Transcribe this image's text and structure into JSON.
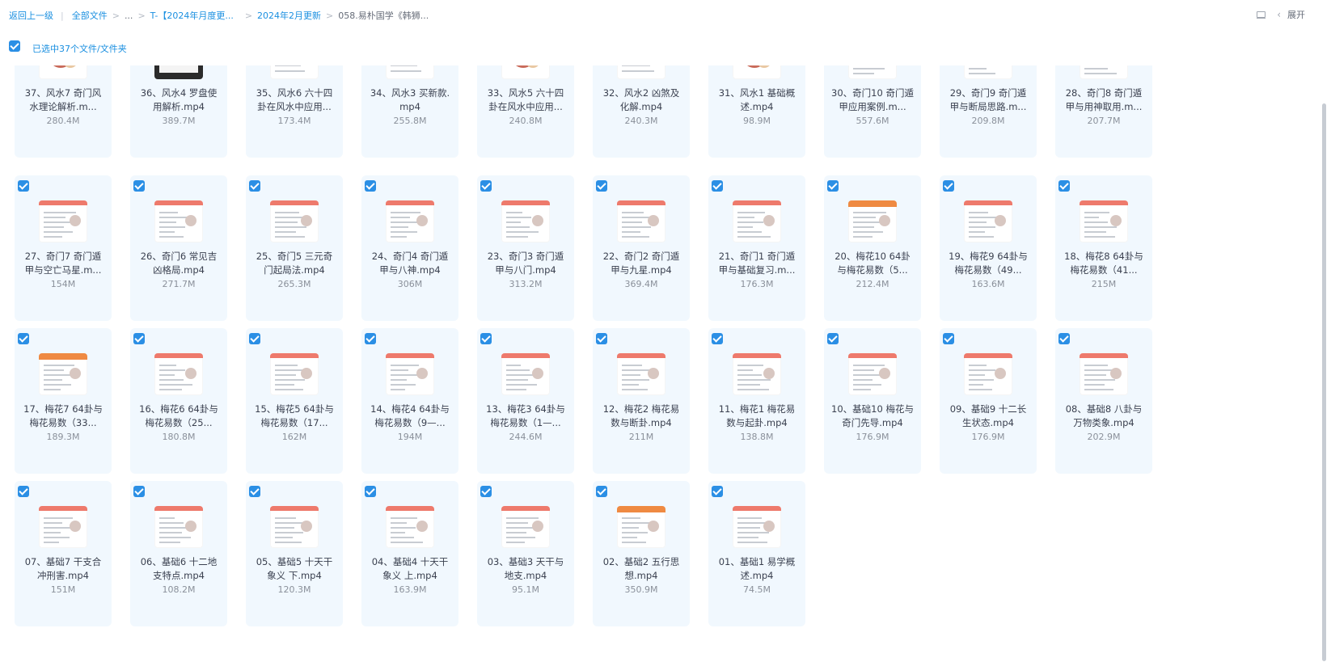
{
  "breadcrumb": {
    "back": "返回上一级",
    "all_files": "全部文件",
    "ellipsis": "...",
    "folder1": "T-【2024年月度更...",
    "folder2": "2024年2月更新",
    "current": "058.易朴国学《韩狮..."
  },
  "toolbar": {
    "expand_label": "展开",
    "layout_icon": "list-layout-icon",
    "chevron_icon": "chevron-left-icon"
  },
  "selection": {
    "text": "已选中37个文件/文件夹"
  },
  "files": [
    {
      "name": "37、风水7 奇门风\n水理论解析.m...",
      "size": "280.4M",
      "thumb": "photo"
    },
    {
      "name": "36、风水4 罗盘使\n用解析.mp4",
      "size": "389.7M",
      "thumb": "dark"
    },
    {
      "name": "35、风水6 六十四\n卦在风水中应用...",
      "size": "173.4M",
      "thumb": "plain"
    },
    {
      "name": "34、风水3 买新款.\nmp4",
      "size": "255.8M",
      "thumb": "plain"
    },
    {
      "name": "33、风水5 六十四\n卦在风水中应用...",
      "size": "240.8M",
      "thumb": "photo"
    },
    {
      "name": "32、风水2 凶煞及\n化解.mp4",
      "size": "240.3M",
      "thumb": "plain"
    },
    {
      "name": "31、风水1 基础概\n述.mp4",
      "size": "98.9M",
      "thumb": "photo"
    },
    {
      "name": "30、奇门10 奇门遁\n甲应用案例.m...",
      "size": "557.6M",
      "thumb": "slide"
    },
    {
      "name": "29、奇门9 奇门遁\n甲与断局思路.m...",
      "size": "209.8M",
      "thumb": "slide"
    },
    {
      "name": "28、奇门8 奇门遁\n甲与用神取用.m...",
      "size": "207.7M",
      "thumb": "slide"
    },
    {
      "name": "27、奇门7 奇门遁\n甲与空亡马星.m...",
      "size": "154M",
      "thumb": "slide"
    },
    {
      "name": "26、奇门6 常见吉\n凶格局.mp4",
      "size": "271.7M",
      "thumb": "slide"
    },
    {
      "name": "25、奇门5 三元奇\n门起局法.mp4",
      "size": "265.3M",
      "thumb": "slide"
    },
    {
      "name": "24、奇门4 奇门遁\n甲与八神.mp4",
      "size": "306M",
      "thumb": "slide"
    },
    {
      "name": "23、奇门3 奇门遁\n甲与八门.mp4",
      "size": "313.2M",
      "thumb": "slide"
    },
    {
      "name": "22、奇门2 奇门遁\n甲与九星.mp4",
      "size": "369.4M",
      "thumb": "slide"
    },
    {
      "name": "21、奇门1 奇门遁\n甲与基础复习.m...",
      "size": "176.3M",
      "thumb": "slide"
    },
    {
      "name": "20、梅花10 64卦\n与梅花易数（5...",
      "size": "212.4M",
      "thumb": "orange"
    },
    {
      "name": "19、梅花9 64卦与\n梅花易数（49...",
      "size": "163.6M",
      "thumb": "slide"
    },
    {
      "name": "18、梅花8 64卦与\n梅花易数（41...",
      "size": "215M",
      "thumb": "slide"
    },
    {
      "name": "17、梅花7 64卦与\n梅花易数（33...",
      "size": "189.3M",
      "thumb": "orange"
    },
    {
      "name": "16、梅花6 64卦与\n梅花易数（25...",
      "size": "180.8M",
      "thumb": "slide"
    },
    {
      "name": "15、梅花5 64卦与\n梅花易数（17...",
      "size": "162M",
      "thumb": "slide"
    },
    {
      "name": "14、梅花4 64卦与\n梅花易数（9—...",
      "size": "194M",
      "thumb": "slide"
    },
    {
      "name": "13、梅花3 64卦与\n梅花易数（1—...",
      "size": "244.6M",
      "thumb": "slide"
    },
    {
      "name": "12、梅花2 梅花易\n数与断卦.mp4",
      "size": "211M",
      "thumb": "slide"
    },
    {
      "name": "11、梅花1 梅花易\n数与起卦.mp4",
      "size": "138.8M",
      "thumb": "slide"
    },
    {
      "name": "10、基础10 梅花与\n奇门先导.mp4",
      "size": "176.9M",
      "thumb": "slide"
    },
    {
      "name": "09、基础9 十二长\n生状态.mp4",
      "size": "176.9M",
      "thumb": "slide"
    },
    {
      "name": "08、基础8 八卦与\n万物类象.mp4",
      "size": "202.9M",
      "thumb": "slide"
    },
    {
      "name": "07、基础7 干支合\n冲刑害.mp4",
      "size": "151M",
      "thumb": "slide"
    },
    {
      "name": "06、基础6 十二地\n支特点.mp4",
      "size": "108.2M",
      "thumb": "slide"
    },
    {
      "name": "05、基础5 十天干\n象义 下.mp4",
      "size": "120.3M",
      "thumb": "slide"
    },
    {
      "name": "04、基础4 十天干\n象义 上.mp4",
      "size": "163.9M",
      "thumb": "slide"
    },
    {
      "name": "03、基础3 天干与\n地支.mp4",
      "size": "95.1M",
      "thumb": "slide"
    },
    {
      "name": "02、基础2 五行思\n想.mp4",
      "size": "350.9M",
      "thumb": "orange"
    },
    {
      "name": "01、基础1 易学概\n述.mp4",
      "size": "74.5M",
      "thumb": "slide"
    }
  ]
}
